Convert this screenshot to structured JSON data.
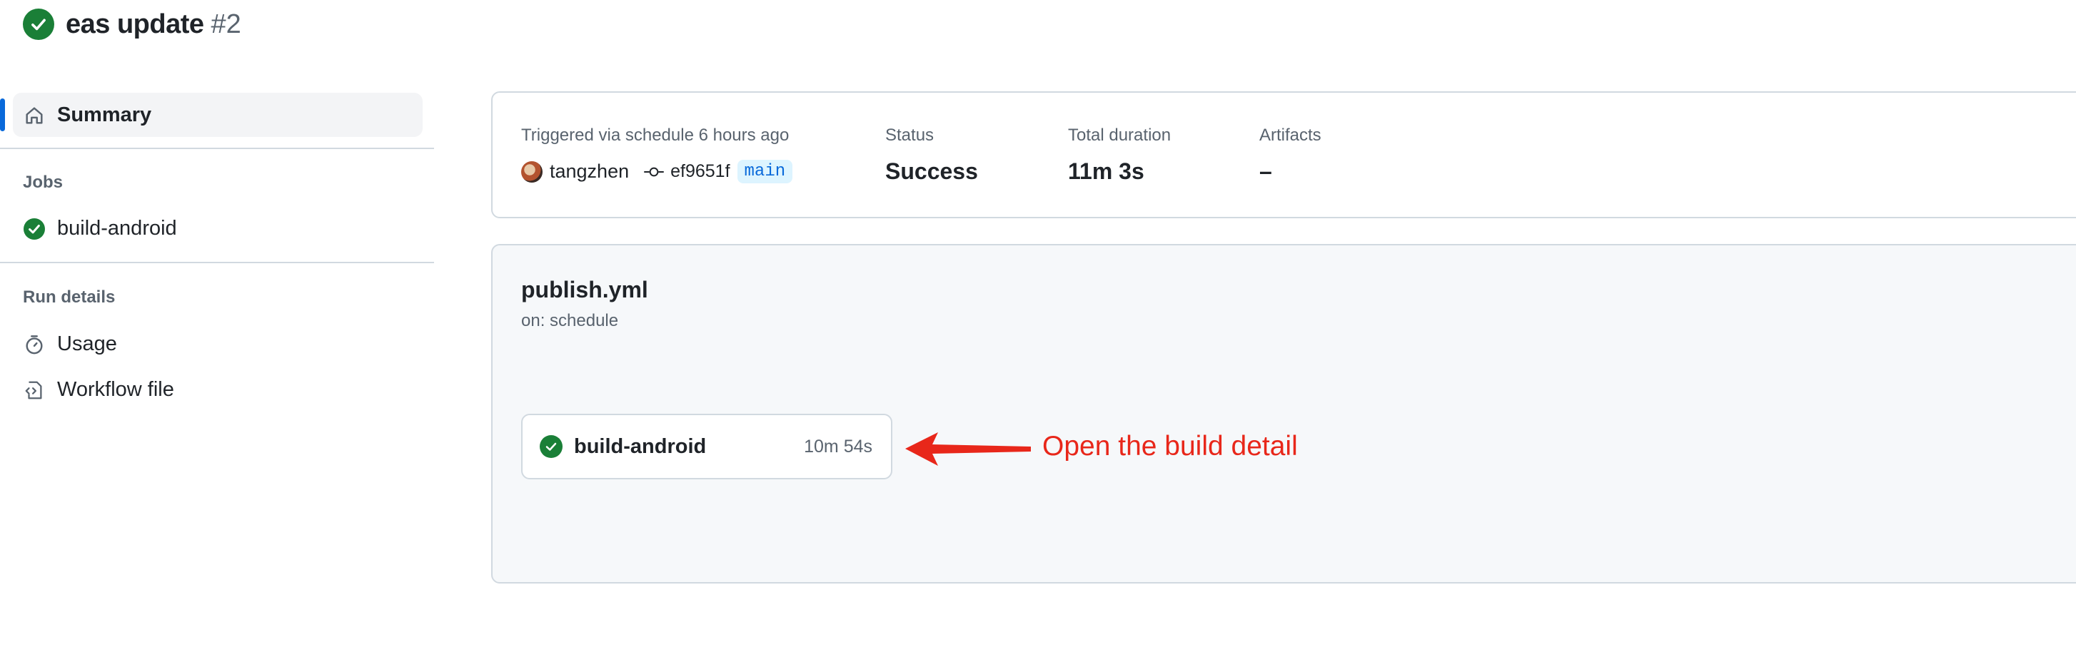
{
  "header": {
    "title": "eas update",
    "run_number": "#2"
  },
  "sidebar": {
    "summary_label": "Summary",
    "jobs_heading": "Jobs",
    "jobs": [
      {
        "label": "build-android",
        "status": "success"
      }
    ],
    "run_details_heading": "Run details",
    "run_details": [
      {
        "label": "Usage",
        "icon": "stopwatch-icon"
      },
      {
        "label": "Workflow file",
        "icon": "file-code-icon"
      }
    ]
  },
  "summary": {
    "trigger_text": "Triggered via schedule 6 hours ago",
    "actor": "tangzhen",
    "commit": "ef9651f",
    "branch": "main",
    "status_label": "Status",
    "status_value": "Success",
    "duration_label": "Total duration",
    "duration_value": "11m 3s",
    "artifacts_label": "Artifacts",
    "artifacts_value": "–"
  },
  "workflow": {
    "name": "publish.yml",
    "trigger": "on: schedule",
    "job": {
      "name": "build-android",
      "duration": "10m 54s"
    }
  },
  "annotation": {
    "text": "Open the build detail",
    "color": "#e8271a"
  },
  "colors": {
    "success": "#1a7f37",
    "accent": "#0969da",
    "annotation": "#e8271a"
  }
}
